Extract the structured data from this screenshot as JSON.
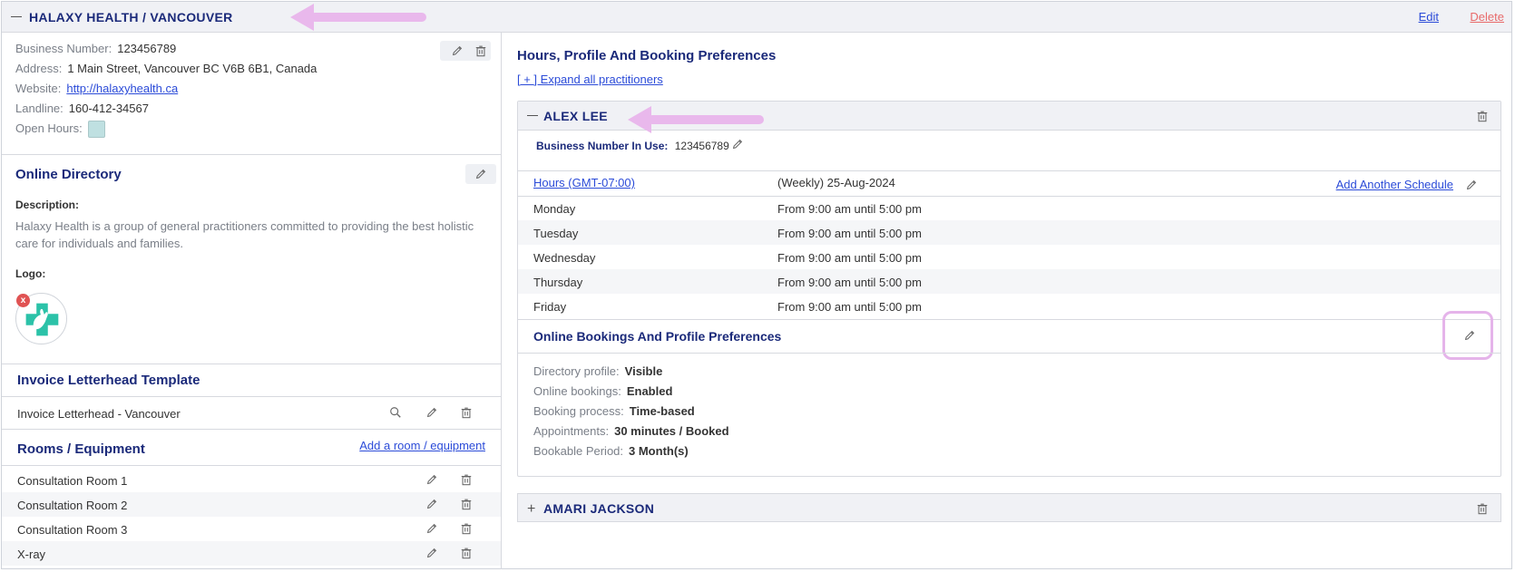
{
  "header": {
    "title": "HALAXY HEALTH / VANCOUVER",
    "edit_label": "Edit",
    "delete_label": "Delete"
  },
  "business": {
    "business_number_label": "Business Number:",
    "business_number": "123456789",
    "address_label": "Address:",
    "address": "1 Main Street, Vancouver BC V6B 6B1, Canada",
    "website_label": "Website:",
    "website": "http://halaxyhealth.ca",
    "landline_label": "Landline:",
    "landline": "160-412-34567",
    "open_hours_label": "Open Hours:"
  },
  "online_directory": {
    "title": "Online Directory",
    "description_label": "Description:",
    "description": "Halaxy Health is a group of general practitioners committed to providing the best holistic care for individuals and families.",
    "logo_label": "Logo:",
    "logo_remove": "x"
  },
  "invoice": {
    "title": "Invoice Letterhead Template",
    "item": "Invoice Letterhead - Vancouver"
  },
  "rooms": {
    "title": "Rooms / Equipment",
    "add_link": "Add a room / equipment",
    "items": [
      "Consultation Room 1",
      "Consultation Room 2",
      "Consultation Room 3",
      "X-ray"
    ]
  },
  "right_panel": {
    "title": "Hours, Profile And Booking Preferences",
    "expand_link": "[ + ] Expand all practitioners"
  },
  "practitioner1": {
    "name": "ALEX LEE",
    "business_number_label": "Business Number In Use:",
    "business_number": "123456789",
    "hours_link": "Hours (GMT-07:00)",
    "schedule_info": "(Weekly) 25-Aug-2024",
    "add_schedule": "Add Another Schedule",
    "hours": [
      {
        "day": "Monday",
        "time": "From 9:00 am until 5:00 pm"
      },
      {
        "day": "Tuesday",
        "time": "From 9:00 am until 5:00 pm"
      },
      {
        "day": "Wednesday",
        "time": "From 9:00 am until 5:00 pm"
      },
      {
        "day": "Thursday",
        "time": "From 9:00 am until 5:00 pm"
      },
      {
        "day": "Friday",
        "time": "From 9:00 am until 5:00 pm"
      }
    ],
    "prefs_title": "Online Bookings And Profile Preferences",
    "prefs": [
      {
        "label": "Directory profile:",
        "value": "Visible"
      },
      {
        "label": "Online bookings:",
        "value": "Enabled"
      },
      {
        "label": "Booking process:",
        "value": "Time-based"
      },
      {
        "label": "Appointments:",
        "value": "30 minutes / Booked"
      },
      {
        "label": "Bookable Period:",
        "value": "3 Month(s)"
      }
    ]
  },
  "practitioner2": {
    "name": "AMARI JACKSON",
    "expand_glyph": "+"
  }
}
